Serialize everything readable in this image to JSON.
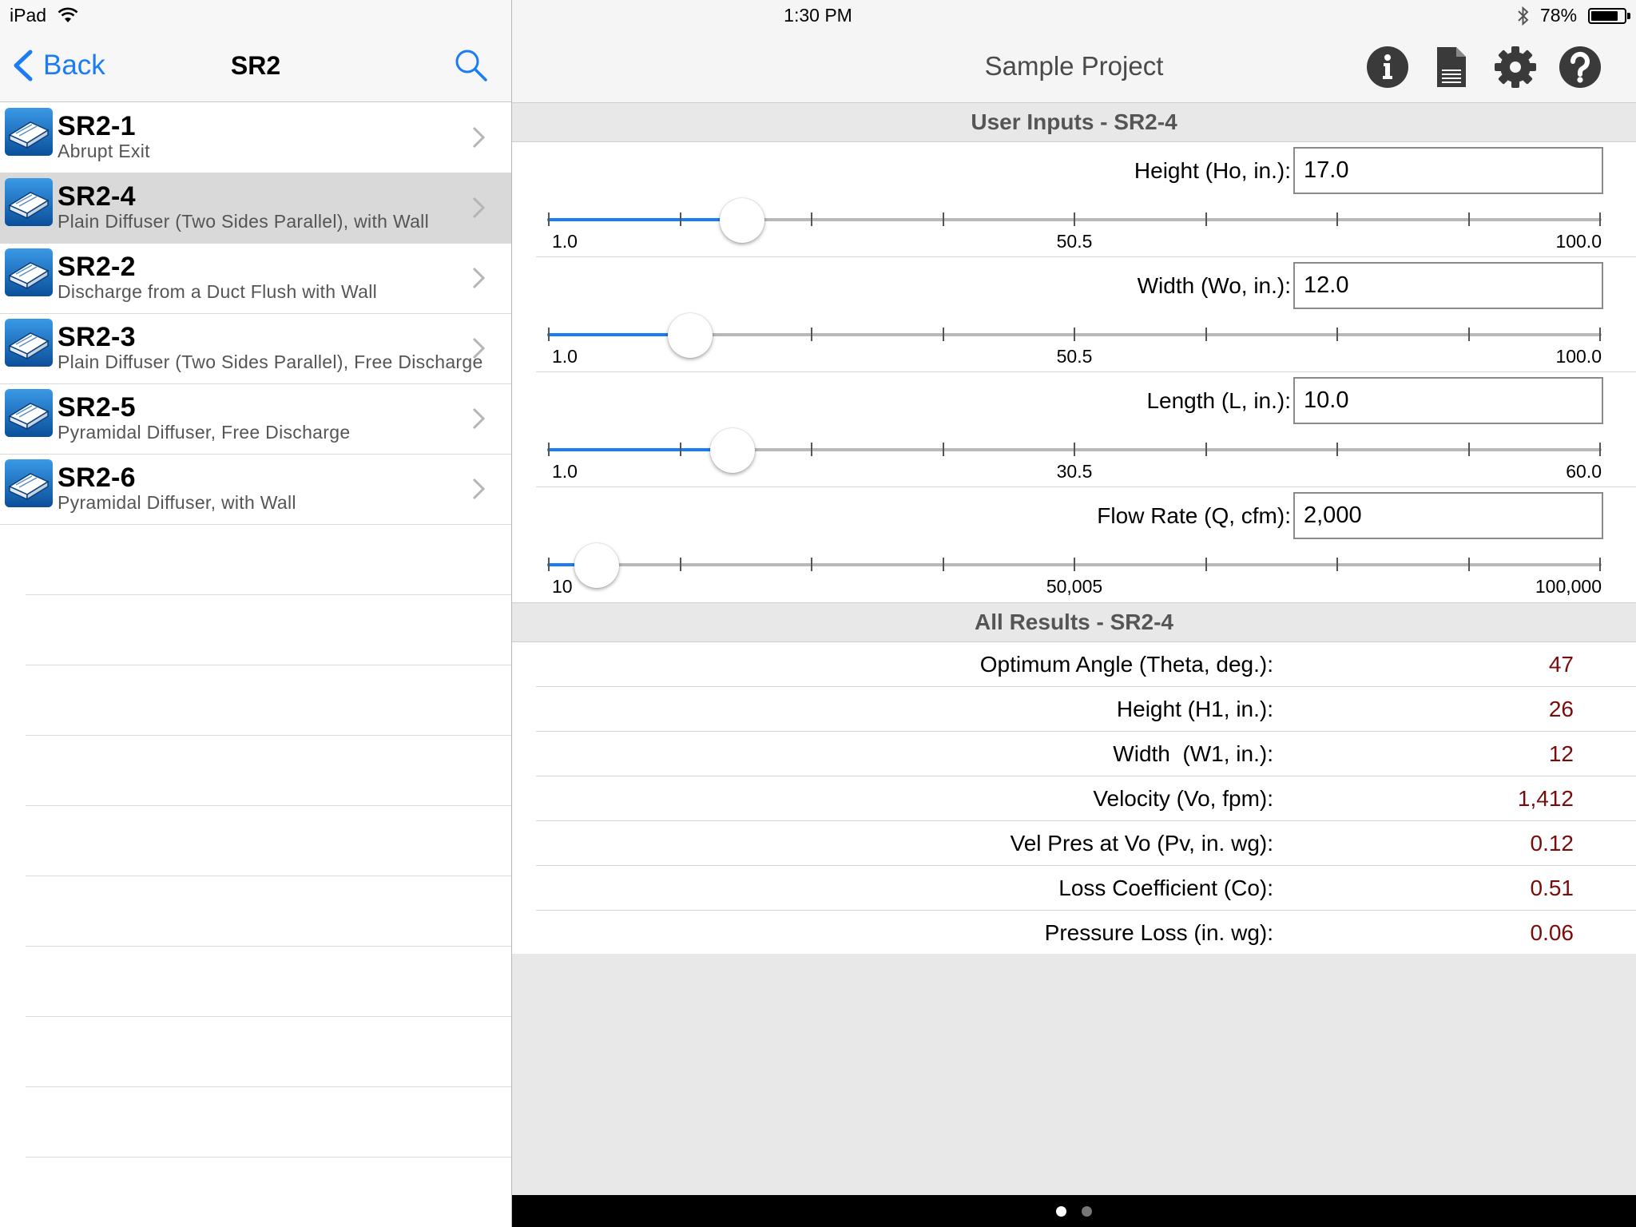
{
  "status_bar": {
    "carrier": "iPad",
    "time": "1:30 PM",
    "battery": "78%",
    "battery_level": 0.78
  },
  "left_nav": {
    "back_label": "Back",
    "title": "SR2"
  },
  "list": {
    "items": [
      {
        "name": "SR2-1",
        "description": "Abrupt Exit",
        "selected": false
      },
      {
        "name": "SR2-4",
        "description": "Plain Diffuser (Two Sides Parallel), with Wall",
        "selected": true
      },
      {
        "name": "SR2-2",
        "description": "Discharge from a Duct Flush with Wall",
        "selected": false
      },
      {
        "name": "SR2-3",
        "description": "Plain Diffuser (Two Sides Parallel), Free Discharge",
        "selected": false
      },
      {
        "name": "SR2-5",
        "description": "Pyramidal Diffuser, Free Discharge",
        "selected": false
      },
      {
        "name": "SR2-6",
        "description": "Pyramidal Diffuser, with Wall",
        "selected": false
      }
    ]
  },
  "right_nav": {
    "title": "Sample Project",
    "icons": [
      "info-icon",
      "document-icon",
      "gear-icon",
      "help-icon"
    ]
  },
  "inputs": {
    "header": "User Inputs - SR2-4",
    "fields": [
      {
        "label": "Height (Ho, in.):",
        "value": "17.0",
        "min": 1.0,
        "max": 100.0,
        "current": 17.0,
        "min_label": "1.0",
        "mid_label": "50.5",
        "max_label": "100.0"
      },
      {
        "label": "Width (Wo, in.):",
        "value": "12.0",
        "min": 1.0,
        "max": 100.0,
        "current": 12.0,
        "min_label": "1.0",
        "mid_label": "50.5",
        "max_label": "100.0"
      },
      {
        "label": "Length (L, in.):",
        "value": "10.0",
        "min": 1.0,
        "max": 60.0,
        "current": 10.0,
        "min_label": "1.0",
        "mid_label": "30.5",
        "max_label": "60.0"
      },
      {
        "label": "Flow Rate (Q, cfm):",
        "value": "2,000",
        "min": 10,
        "max": 100000,
        "current": 2000,
        "min_label": "10",
        "mid_label": "50,005",
        "max_label": "100,000"
      }
    ]
  },
  "results": {
    "header": "All Results - SR2-4",
    "rows": [
      {
        "label": "Optimum Angle (Theta, deg.):",
        "value": "47"
      },
      {
        "label": "Height (H1, in.):",
        "value": "26"
      },
      {
        "label": "Width  (W1, in.):",
        "value": "12"
      },
      {
        "label": "Velocity (Vo, fpm):",
        "value": "1,412"
      },
      {
        "label": "Vel Pres at Vo (Pv, in. wg):",
        "value": "0.12"
      },
      {
        "label": "Loss Coefficient (Co):",
        "value": "0.51"
      },
      {
        "label": "Pressure Loss (in. wg):",
        "value": "0.06"
      }
    ]
  },
  "colors": {
    "accent": "#1b7cf5",
    "result_value": "#7a0b0b",
    "selected_row": "#d9d9d9"
  },
  "page_control": {
    "pages": 2,
    "current": 0
  }
}
